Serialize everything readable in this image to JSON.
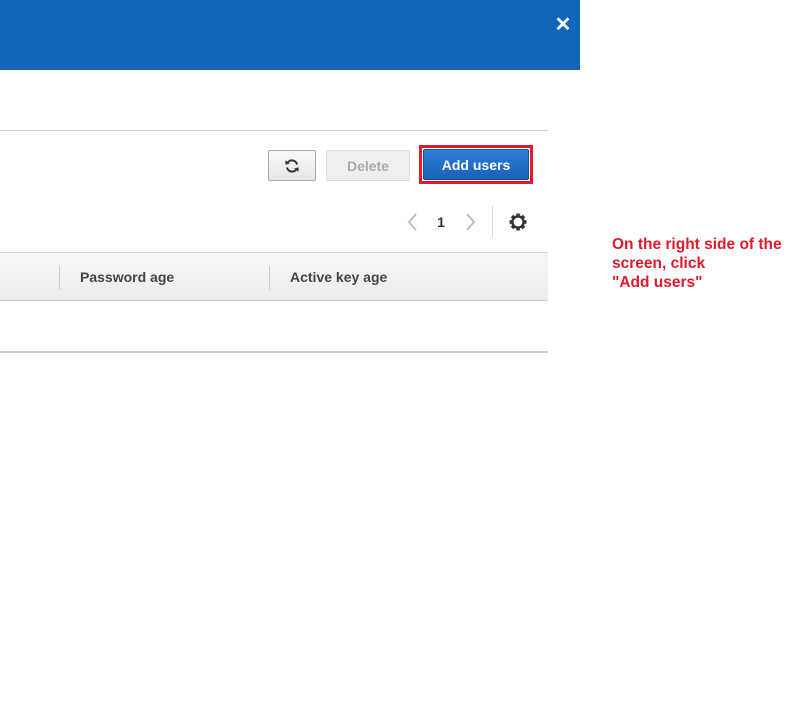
{
  "banner": {
    "close_icon": "close-icon",
    "close_symbol": "✕",
    "color": "#1166bb"
  },
  "toolbar": {
    "refresh_icon": "refresh-icon",
    "delete_label": "Delete",
    "add_users_label": "Add users",
    "highlight_color": "#e01a2b"
  },
  "pagination": {
    "prev_icon": "chevron-left-icon",
    "page": "1",
    "next_icon": "chevron-right-icon",
    "settings_icon": "gear-icon"
  },
  "table": {
    "columns": [
      {
        "label": ""
      },
      {
        "label": "Password age"
      },
      {
        "label": "Active key age"
      }
    ]
  },
  "annotation": {
    "lines": [
      "On the right side of the",
      "screen, click",
      "\"Add users\""
    ],
    "color": "#e01a2b"
  }
}
